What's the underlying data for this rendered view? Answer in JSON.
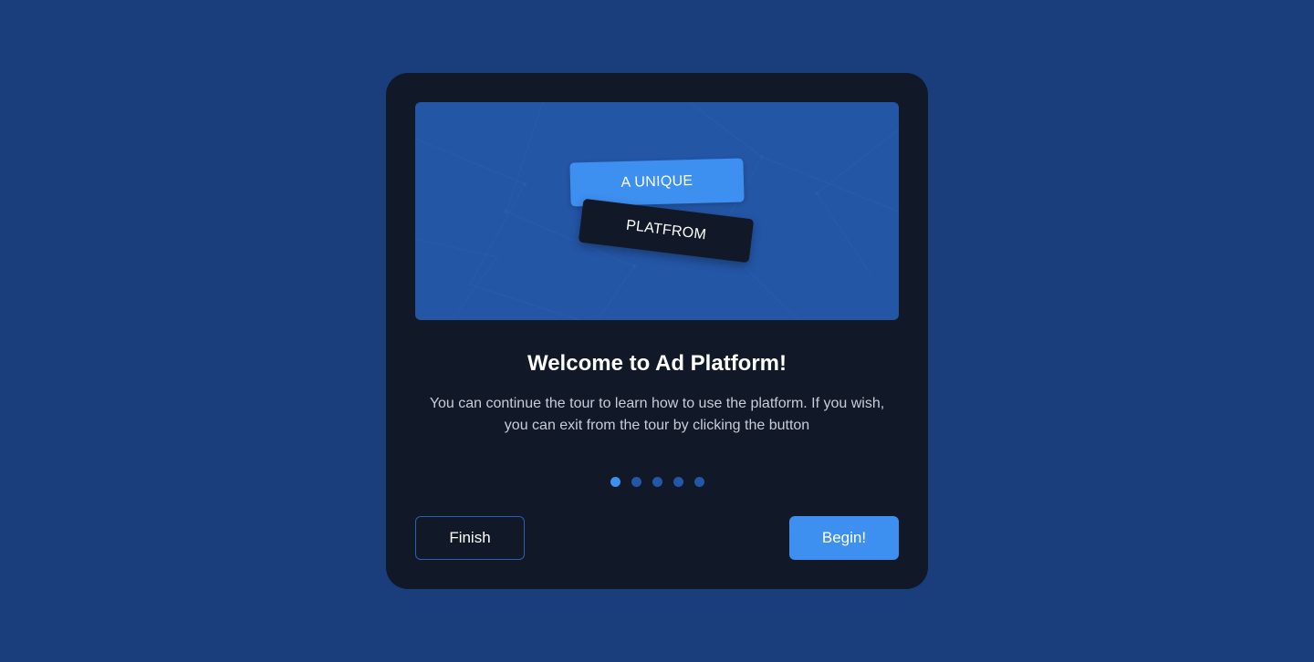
{
  "modal": {
    "hero": {
      "tag_top": "A UNIQUE",
      "tag_bottom": "PLATFROM"
    },
    "title": "Welcome to Ad Platform!",
    "description": "You can continue the tour to learn how to use the platform. If you wish, you can exit from the tour by clicking the button",
    "pagination": {
      "total": 5,
      "current": 1
    },
    "buttons": {
      "finish_label": "Finish",
      "begin_label": "Begin!"
    }
  },
  "colors": {
    "page_background": "#1a3d7c",
    "modal_background": "#111827",
    "hero_background": "#2456a6",
    "accent": "#3d8ff0",
    "dot_inactive": "#2456a6"
  }
}
